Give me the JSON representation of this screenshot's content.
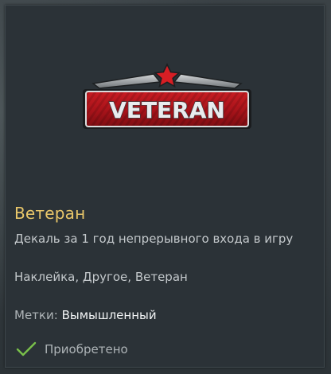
{
  "item": {
    "title": "Ветеран",
    "description": "Декаль за 1 год непрерывного входа в игру",
    "categories": "Наклейка, Другое, Ветеран",
    "tags_label": "Метки:",
    "tags_value": "Вымышленный",
    "status": "Приобретено",
    "decal_text": "VETERAN"
  },
  "icons": {
    "status": "checkmark-icon",
    "decal_emblem": "star-icon"
  },
  "colors": {
    "title": "#e9c76a",
    "decal_red": "#b3151b",
    "checkmark": "#79c04a",
    "card_bg": "#2b3237"
  }
}
